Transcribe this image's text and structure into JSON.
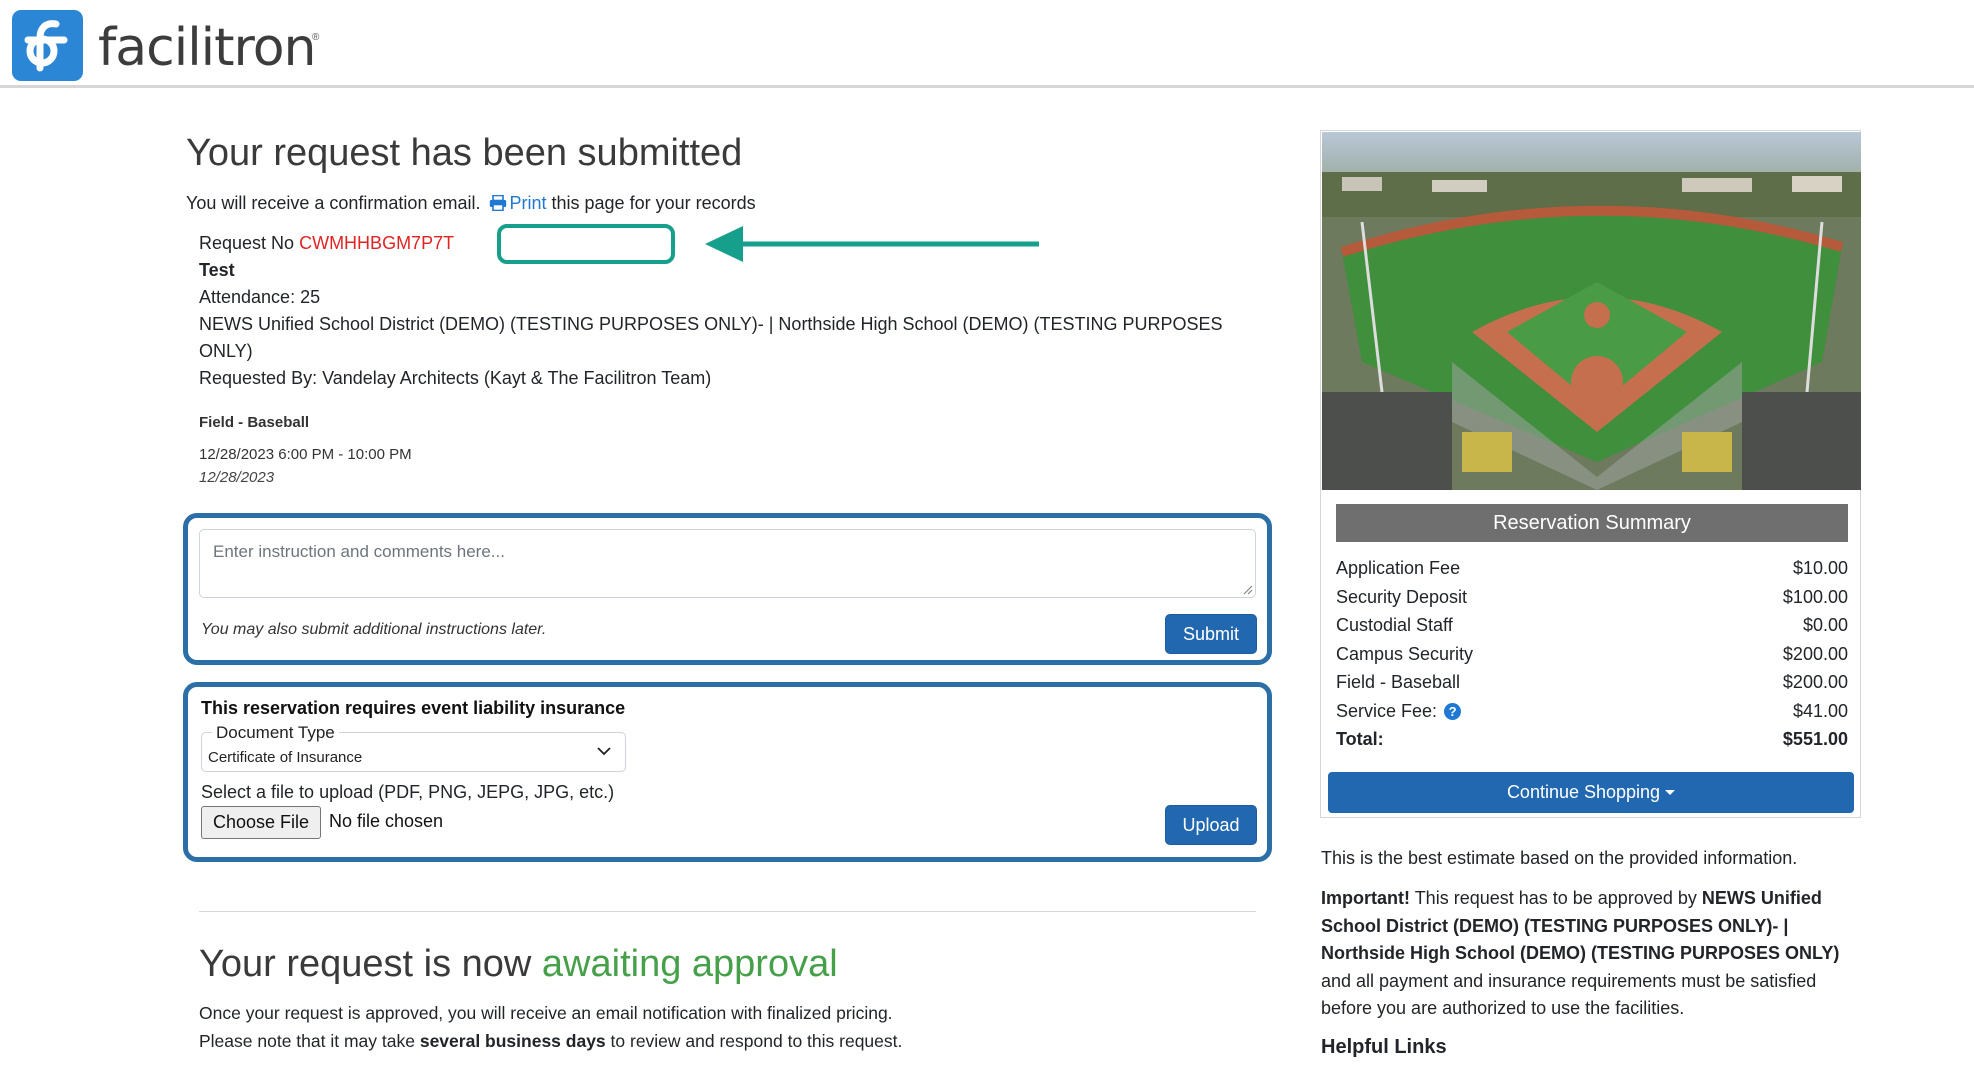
{
  "header": {
    "logo_text": "facilitron",
    "logo_reg": "®"
  },
  "confirmation": {
    "title": "Your request has been submitted",
    "email_text": "You will receive a confirmation email.",
    "print_label": "Print",
    "print_suffix": "this page for your records"
  },
  "request": {
    "number_label": "Request No",
    "number": "CWMHHBGM7P7T",
    "name": "Test",
    "attendance": "Attendance: 25",
    "location": "NEWS Unified School District (DEMO) (TESTING PURPOSES ONLY)- | Northside High School (DEMO) (TESTING PURPOSES ONLY)",
    "requested_by": "Requested By: Vandelay Architects (Kayt & The Facilitron Team)",
    "facility": "Field - Baseball",
    "time_range": "12/28/2023 6:00 PM - 10:00 PM",
    "date": "12/28/2023"
  },
  "comments": {
    "placeholder": "Enter instruction and comments here...",
    "note": "You may also submit additional instructions later.",
    "submit_label": "Submit"
  },
  "insurance": {
    "title": "This reservation requires event liability insurance",
    "doc_type_label": "Document Type",
    "doc_type_value": "Certificate of Insurance",
    "upload_label": "Select a file to upload (PDF, PNG, JEPG, JPG, etc.)",
    "choose_file_label": "Choose File",
    "no_file_text": "No file chosen",
    "upload_button": "Upload"
  },
  "approval": {
    "heading_prefix": "Your request is now",
    "heading_status": "awaiting approval",
    "line1": "Once your request is approved, you will receive an email notification with finalized pricing.",
    "line2_prefix": "Please note that it may take",
    "line2_bold": "several business days",
    "line2_suffix": "to review and respond to this request."
  },
  "summary": {
    "title": "Reservation Summary",
    "rows": [
      {
        "label": "Application Fee",
        "value": "$10.00"
      },
      {
        "label": "Security Deposit",
        "value": "$100.00"
      },
      {
        "label": "Custodial Staff",
        "value": "$0.00"
      },
      {
        "label": "Campus Security",
        "value": "$200.00"
      },
      {
        "label": "Field - Baseball",
        "value": "$200.00"
      },
      {
        "label": "Service Fee:",
        "value": "$41.00"
      },
      {
        "label": "Total:",
        "value": "$551.00"
      }
    ],
    "continue_label": "Continue Shopping"
  },
  "notes": {
    "estimate": "This is the best estimate based on the provided information.",
    "important_label": "Important!",
    "important_text": "This request has to be approved by",
    "important_entity": "NEWS Unified School District (DEMO) (TESTING PURPOSES ONLY)- | Northside High School (DEMO) (TESTING PURPOSES ONLY)",
    "important_suffix": "and all payment and insurance requirements must be satisfied before you are authorized to use the facilities.",
    "helpful_links": "Helpful Links"
  },
  "colors": {
    "brand_blue": "#2268b0",
    "link_blue": "#1f78d1",
    "request_red": "#e02424",
    "highlight_teal": "#169f8b",
    "status_green": "#46a049"
  }
}
